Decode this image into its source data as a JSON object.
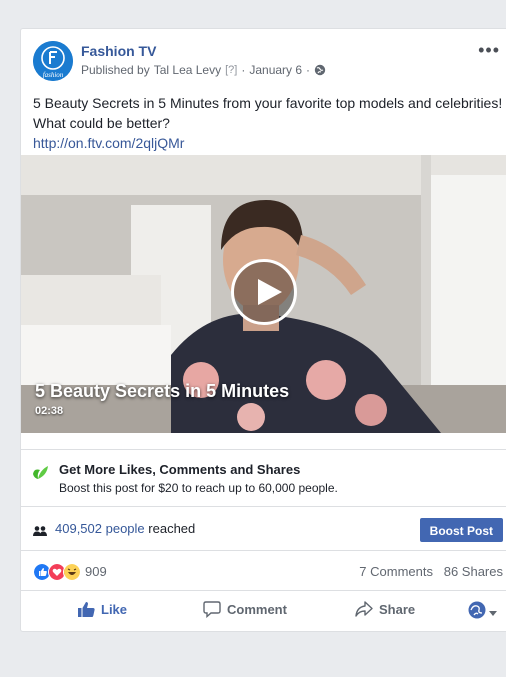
{
  "post": {
    "page_name": "Fashion TV",
    "published_prefix": "Published by",
    "author": "Tal Lea Levy",
    "help": "[?]",
    "date": "January 6",
    "separator": "·",
    "more": "•••",
    "text": "5 Beauty Secrets in 5 Minutes from your favorite top models and celebrities! What could be better?",
    "link": "http://on.ftv.com/2qljQMr",
    "avatar_label": "fashion"
  },
  "video": {
    "title": "5 Beauty Secrets in 5 Minutes",
    "duration": "02:38"
  },
  "promo": {
    "title": "Get More Likes, Comments and Shares",
    "subtitle": "Boost this post for $20 to reach up to 60,000 people."
  },
  "reach": {
    "count": "409,502 people",
    "suffix": "reached",
    "boost_label": "Boost Post"
  },
  "stats": {
    "reactions": "909",
    "comments": "7 Comments",
    "shares": "86 Shares"
  },
  "actions": {
    "like": "Like",
    "comment": "Comment",
    "share": "Share"
  },
  "colors": {
    "link": "#385898",
    "boost": "#4267b2",
    "promo_icon": "#42b72a"
  }
}
